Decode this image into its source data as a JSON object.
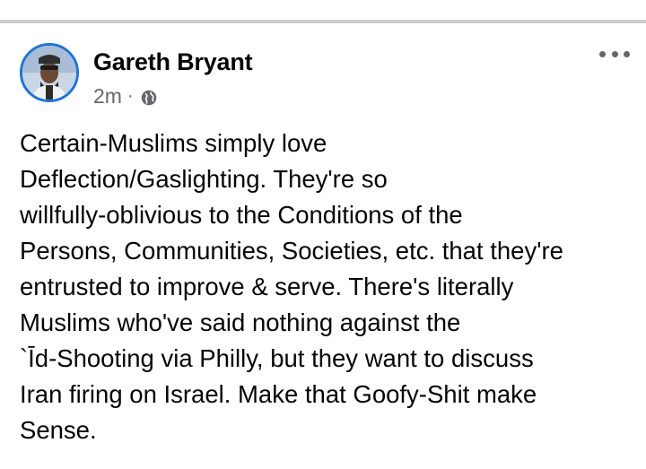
{
  "post": {
    "author_name": "Gareth Bryant",
    "timestamp": "2m",
    "separator": "·",
    "audience_icon": "globe-icon",
    "more_icon": "more-options-icon",
    "text_lines": [
      "Certain-Muslims simply love",
      "Deflection/Gaslighting. They're so",
      "willfully-oblivious to the Conditions of the",
      "Persons, Communities, Societies, etc. that they're",
      "entrusted to improve & serve. There's literally",
      "Muslims who've said nothing against the",
      "`Īd-Shooting via Philly, but they want to discuss",
      "Iran firing on Israel. Make that Goofy-Shit make",
      "Sense."
    ]
  },
  "colors": {
    "avatar_ring": "#1b74e4",
    "author_text": "#050505",
    "meta_text": "#65676b",
    "divider": "#cbcdd1"
  }
}
